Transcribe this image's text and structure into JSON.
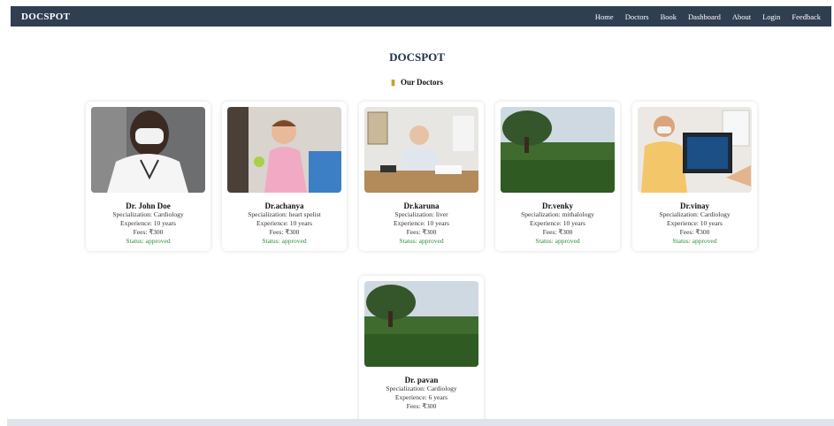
{
  "navbar": {
    "brand": "DOCSPOT",
    "links": [
      "Home",
      "Doctors",
      "Book",
      "Dashboard",
      "About",
      "Login",
      "Feedback"
    ]
  },
  "page_title": "DOCSPOT",
  "section_heading": "Our Doctors",
  "doctors": [
    {
      "name": "Dr. John Doe",
      "specialization": "Specialization: Cardiology",
      "experience": "Experience: 10 years",
      "fees": "Fees: ₹300",
      "status": "Status: approved"
    },
    {
      "name": "Dr.achanya",
      "specialization": "Specialization: heart spelist",
      "experience": "Experience: 10 years",
      "fees": "Fees: ₹300",
      "status": "Status: approved"
    },
    {
      "name": "Dr.karuna",
      "specialization": "Specialization: liver",
      "experience": "Experience: 10 years",
      "fees": "Fees: ₹300",
      "status": "Status: approved"
    },
    {
      "name": "Dr.venky",
      "specialization": "Specialization: mithalology",
      "experience": "Experience: 10 years",
      "fees": "Fees: ₹300",
      "status": "Status: approved"
    },
    {
      "name": "Dr.vinay",
      "specialization": "Specialization: Cardiology",
      "experience": "Experience: 10 years",
      "fees": "Fees: ₹300",
      "status": "Status: approved"
    },
    {
      "name": "Dr. pavan",
      "specialization": "Specialization: Cardiology",
      "experience": "Experience: 6 years",
      "fees": "Fees: ₹300",
      "status": ""
    }
  ],
  "colors": {
    "navbar_bg": "#2f3e50",
    "title": "#1f2f4a",
    "status_approved": "#2e8b3a"
  },
  "icons": {
    "section_heading_icon": "doctor-icon"
  }
}
